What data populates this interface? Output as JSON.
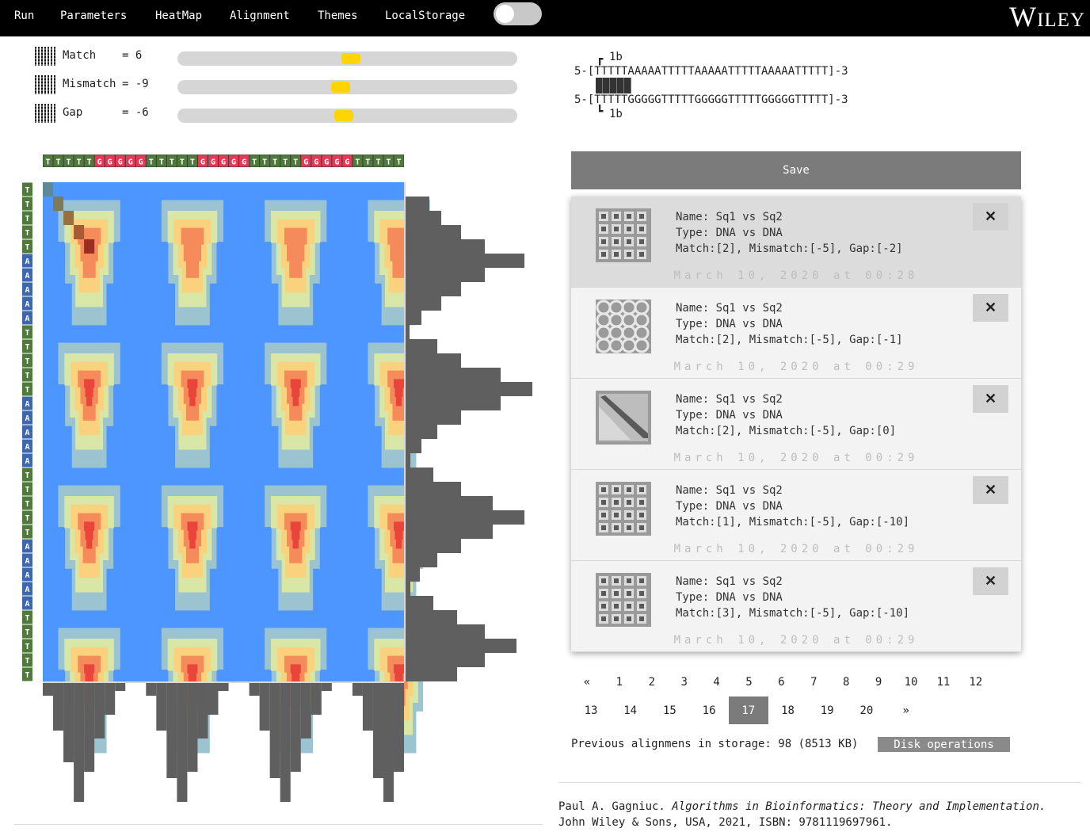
{
  "menu": {
    "run": "Run",
    "parameters": "Parameters",
    "heatmap": "HeatMap",
    "alignment": "Alignment",
    "themes": "Themes",
    "localstorage": "LocalStorage"
  },
  "brand": "Wiley",
  "params": [
    {
      "label": "Match",
      "eq": "= 6",
      "value": 6,
      "fraction": 0.51
    },
    {
      "label": "Mismatch",
      "eq": "= -9",
      "value": -9,
      "fraction": 0.48
    },
    {
      "label": "Gap",
      "eq": "= -6",
      "value": -6,
      "fraction": 0.49
    }
  ],
  "alignment": {
    "top_marker": "1b",
    "seq1": "5-[TTTTTAAAAATTTTTAAAAATTTTTAAAAATTTTT]-3",
    "seq2": "5-[TTTTTGGGGGTTTTTGGGGGTTTTTGGGGGTTTTT]-3",
    "bottom_marker": "1b"
  },
  "heatmap": {
    "top_sequence": "TTTTTGGGGGTTTTTGGGGGTTTTTGGGGGTTTTT",
    "left_sequence": "TTTTTAAAAATTTTTAAAAATTTTTAAAAATTTTT",
    "colors": {
      "T": "#4f7a3b",
      "G": "#e33a55",
      "A": "#3f67ad",
      "background": "#4d96ff",
      "histogram": "#5f5f5f"
    }
  },
  "save_label": "Save",
  "records": [
    {
      "name": "Name: Sq1 vs Sq2",
      "type": "Type: DNA vs DNA",
      "params": "Match:[2], Mismatch:[-5], Gap:[-2]",
      "date": "March 10, 2020 at 00:28",
      "thumb": "grid-dots"
    },
    {
      "name": "Name: Sq1 vs Sq2",
      "type": "Type: DNA vs DNA",
      "params": "Match:[2], Mismatch:[-5], Gap:[-1]",
      "date": "March 10, 2020 at 00:29",
      "thumb": "grid-rings"
    },
    {
      "name": "Name: Sq1 vs Sq2",
      "type": "Type: DNA vs DNA",
      "params": "Match:[2], Mismatch:[-5], Gap:[0]",
      "date": "March 10, 2020 at 00:29",
      "thumb": "diagonal"
    },
    {
      "name": "Name: Sq1 vs Sq2",
      "type": "Type: DNA vs DNA",
      "params": "Match:[1], Mismatch:[-5], Gap:[-10]",
      "date": "March 10, 2020 at 00:29",
      "thumb": "grid-dots"
    },
    {
      "name": "Name: Sq1 vs Sq2",
      "type": "Type: DNA vs DNA",
      "params": "Match:[3], Mismatch:[-5], Gap:[-10]",
      "date": "March 10, 2020 at 00:29",
      "thumb": "grid-dots"
    }
  ],
  "close_label": "✕",
  "pagination": {
    "prev": "«",
    "next": "»",
    "pages": [
      "1",
      "2",
      "3",
      "4",
      "5",
      "6",
      "7",
      "8",
      "9",
      "10",
      "11",
      "12",
      "13",
      "14",
      "15",
      "16",
      "17",
      "18",
      "19",
      "20"
    ],
    "active": "17"
  },
  "storage_text": "Previous alignmens in storage: 98 (8513 KB)",
  "disk_label": "Disk operations",
  "citation": {
    "author": "Paul A. Gagniuc.",
    "title": "Algorithms in Bioinformatics: Theory and Implementation.",
    "publisher": "John Wiley & Sons, USA, 2021, ISBN: 9781119697961."
  }
}
